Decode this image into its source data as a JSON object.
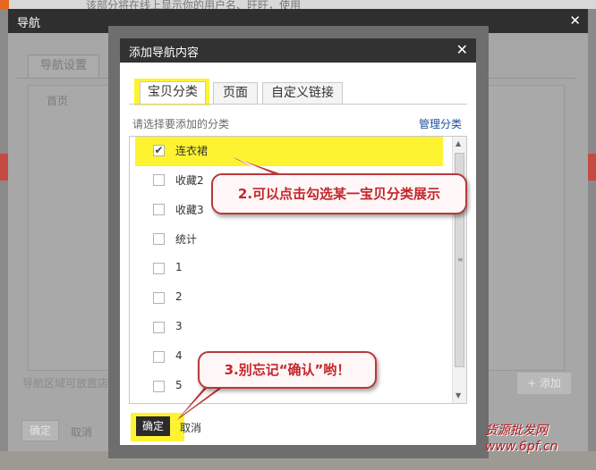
{
  "background": {
    "top_text": "该部分将在线上显示你的用户名、旺旺，使用"
  },
  "outer_dialog": {
    "title": "导航",
    "tab": "导航设置",
    "home_item": "首页",
    "tip": "导航区域可放置店铺",
    "add_button": "+ 添加",
    "confirm": "确定",
    "cancel": "取消"
  },
  "dialog": {
    "title": "添加导航内容",
    "tabs": [
      {
        "label": "宝贝分类",
        "active": true
      },
      {
        "label": "页面",
        "active": false
      },
      {
        "label": "自定义链接",
        "active": false
      }
    ],
    "prompt": "请选择要添加的分类",
    "manage_link": "管理分类",
    "categories": [
      {
        "label": "连衣裙",
        "checked": true
      },
      {
        "label": "收藏2",
        "checked": false
      },
      {
        "label": "收藏3",
        "checked": false
      },
      {
        "label": "统计",
        "checked": false
      },
      {
        "label": "1",
        "checked": false
      },
      {
        "label": "2",
        "checked": false
      },
      {
        "label": "3",
        "checked": false
      },
      {
        "label": "4",
        "checked": false
      },
      {
        "label": "5",
        "checked": false
      }
    ],
    "confirm": "确定",
    "cancel": "取消"
  },
  "callouts": [
    {
      "text": "2.可以点击勾选某一宝贝分类展示"
    },
    {
      "text": "3.别忘记“确认”哟！"
    }
  ],
  "watermark": {
    "line1": "货源批发网",
    "line2": "www.6pf.cn"
  },
  "colors": {
    "highlight": "#fdf331",
    "callout_border": "#b8393a",
    "callout_text": "#c3262b",
    "link": "#1d4ea0",
    "dialog_header": "#323232"
  }
}
